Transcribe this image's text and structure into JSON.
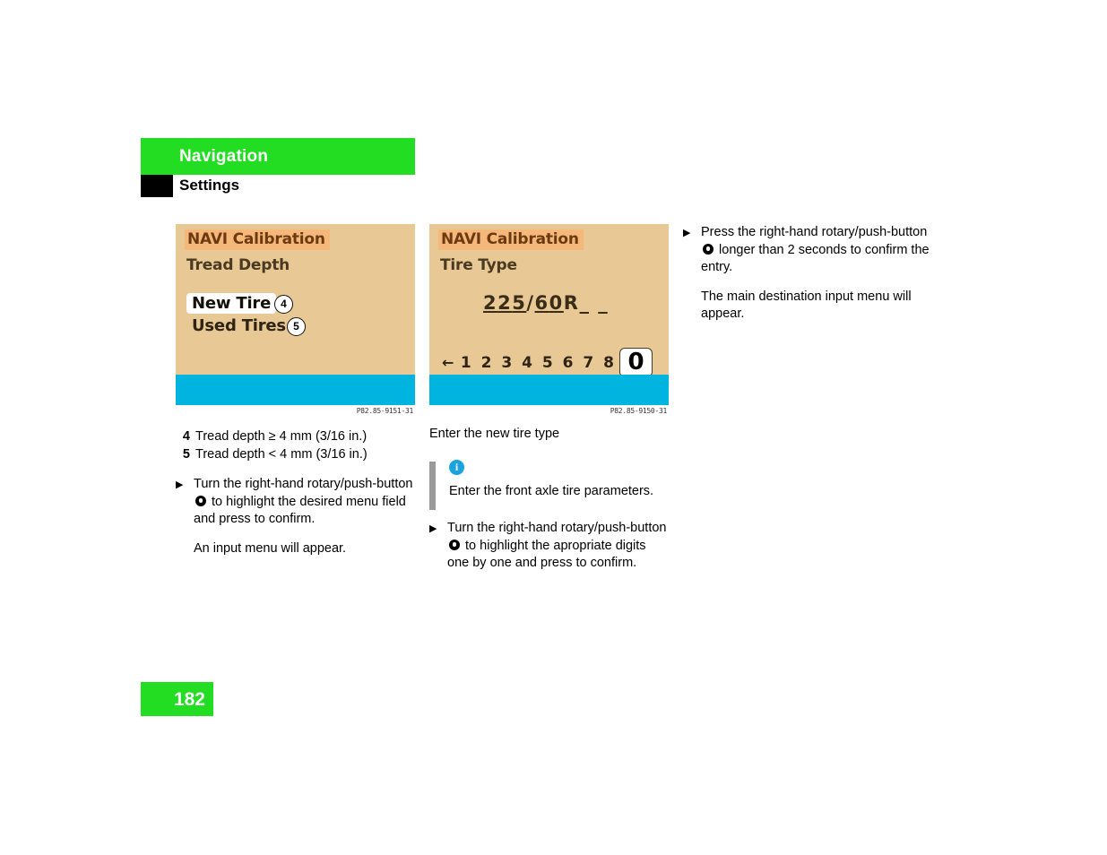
{
  "header": {
    "chapter": "Navigation",
    "section": "Settings"
  },
  "figures": [
    {
      "screen_title": "NAVI Calibration",
      "screen_subtitle": "Tread Depth",
      "menu_items": [
        {
          "label": "New Tire",
          "badge": "4",
          "selected": true
        },
        {
          "label": "Used Tires",
          "badge": "5",
          "selected": false
        }
      ],
      "caption": "P82.85-9151-31"
    },
    {
      "screen_title": "NAVI Calibration",
      "screen_subtitle": "Tire Type",
      "tire_size": {
        "underlined_1": "2",
        "underlined_2": "2",
        "underlined_3": "5",
        "slash": "/",
        "underlined_4": "6",
        "underlined_5": "0",
        "letter": "R",
        "blanks": "_ _"
      },
      "digit_row": {
        "arrow": "←",
        "digits": "1 2 3 4 5 6 7 8",
        "selected_digit": "0"
      },
      "caption": "P82.85-9150-31"
    }
  ],
  "left_column": {
    "legend": [
      {
        "num": "4",
        "text": "Tread depth ≥ 4 mm (3/16 in.)"
      },
      {
        "num": "5",
        "text": "Tread depth < 4 mm (3/16 in.)"
      }
    ],
    "step": {
      "bullet": "▶",
      "text_before": "Turn the right-hand rotary/push-button",
      "text_after": "to highlight the desired menu field and press to confirm."
    },
    "result": "An input menu will appear."
  },
  "middle_column": {
    "intro": "Enter the new tire type",
    "note": {
      "icon": "i",
      "text": "Enter the front axle tire parameters."
    },
    "step": {
      "bullet": "▶",
      "text_before": "Turn the right-hand rotary/push-button",
      "text_after": "to highlight the apropriate digits one by one and press to confirm."
    }
  },
  "right_column": {
    "step": {
      "bullet": "▶",
      "text_before": "Press the right-hand rotary/push-button",
      "text_after": "longer than 2 seconds to confirm the entry."
    },
    "result": "The main destination input menu will appear."
  },
  "footer": {
    "page_number": "182"
  },
  "colors": {
    "brand_green": "#22dd22",
    "screen_background": "#e8c894",
    "screen_title_highlight": "#f5b87a",
    "screen_bottom_bar": "#00b4e0",
    "note_icon_blue": "#1ba3e0",
    "note_bar_gray": "#9a9a9a"
  }
}
